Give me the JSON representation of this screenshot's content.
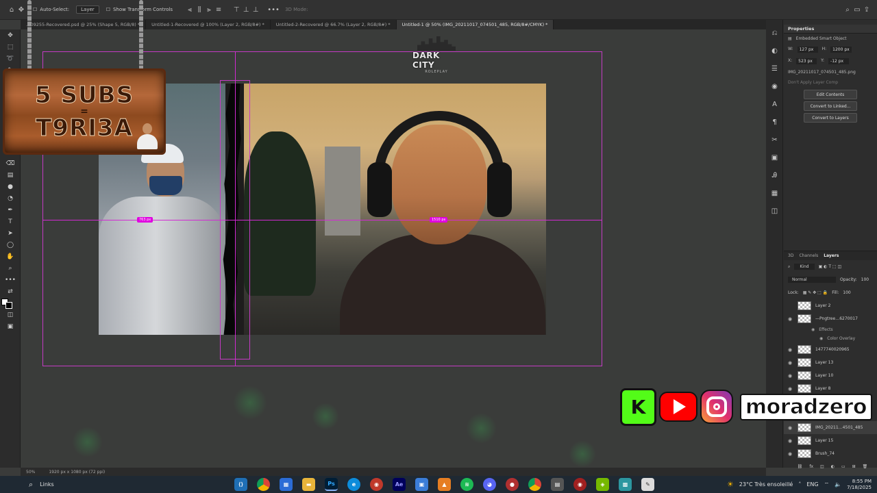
{
  "options_bar": {
    "auto_select_label": "Auto-Select:",
    "auto_select_value": "Layer",
    "transform_controls_label": "Show Transform Controls",
    "mode_label": "3D Mode:"
  },
  "tabs": [
    {
      "label": "…09255-Recovered.psd @ 25% (Shape 5, RGB/8) *"
    },
    {
      "label": "Untitled-1-Recovered @ 100% (Layer 2, RGB/8#) *"
    },
    {
      "label": "Untitled-2-Recovered @ 66.7% (Layer 2, RGB/8#) *"
    },
    {
      "label": "Untitled-1 @ 50% (IMG_20211017_074501_485, RGB/8#/CMYK) *"
    }
  ],
  "canvas": {
    "measure_left": "763 px",
    "measure_right": "1510 px",
    "logo_line1": "DARK CITY",
    "logo_line2": "ROLEPLAY"
  },
  "sign": {
    "line1": "5 SUBS",
    "line2": "=",
    "line3": "T9RI3A"
  },
  "socials": {
    "kick_letter": "K",
    "username": "moradzero"
  },
  "properties": {
    "title": "Properties",
    "object_type": "Embedded Smart Object",
    "w_label": "W:",
    "w_value": "127 px",
    "h_label": "H:",
    "h_value": "1200 px",
    "x_label": "X:",
    "x_value": "523 px",
    "y_label": "Y:",
    "y_value": "-12 px",
    "filename": "IMG_20211017_074501_485.png",
    "layer_comp": "Don't Apply Layer Comp",
    "btn_edit": "Edit Contents",
    "btn_linked": "Convert to Linked...",
    "btn_layers": "Convert to Layers"
  },
  "layers_panel": {
    "tabs": [
      "3D",
      "Channels",
      "Layers"
    ],
    "kind_label": "Kind",
    "blend_mode": "Normal",
    "opacity_label": "Opacity:",
    "opacity_value": "100",
    "lock_label": "Lock:",
    "fill_label": "Fill:",
    "fill_value": "100",
    "items": [
      {
        "name": "Layer 2"
      },
      {
        "name": "—Pngtree…6270017"
      },
      {
        "name": "Effects"
      },
      {
        "name": "Color Overlay"
      },
      {
        "name": "1477740020965"
      },
      {
        "name": "Layer 13"
      },
      {
        "name": "Layer 10"
      },
      {
        "name": "Layer 8"
      },
      {
        "name": "IMG_20211…4501_485"
      },
      {
        "name": "Layer 15"
      },
      {
        "name": "Brush_74"
      }
    ]
  },
  "status_bar": {
    "zoom": "50%",
    "doc_size": "1920 px x 1080 px (72 ppi)"
  },
  "taskbar": {
    "search_text": "Links",
    "weather": "23°C Très ensoleillé",
    "language": "ENG",
    "time": "8:55 PM",
    "date": "7/18/2025"
  },
  "colors": {
    "guide": "#d22ad2",
    "kick_green": "#53fc18",
    "youtube_red": "#ff0000"
  }
}
